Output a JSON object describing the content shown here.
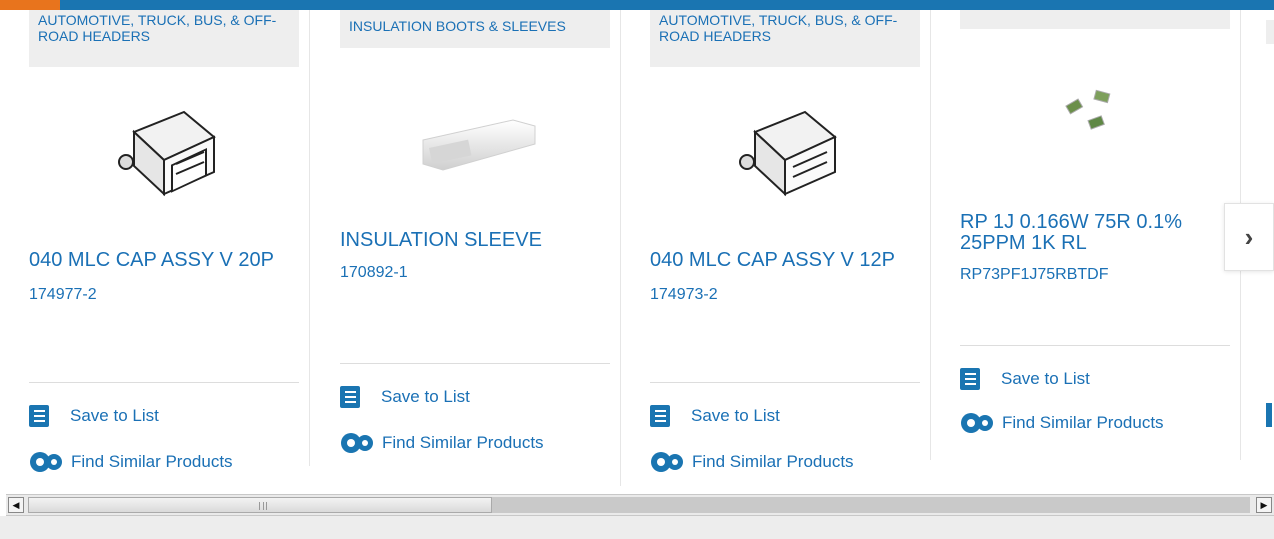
{
  "colors": {
    "accent_blue": "#1a75b1",
    "accent_orange": "#e8741d",
    "link": "#1a70b5"
  },
  "cards": [
    {
      "category": "AUTOMOTIVE, TRUCK, BUS, & OFF-ROAD HEADERS",
      "title": "040 MLC CAP ASSY V 20P",
      "part_number": "174977-2",
      "image": "header-connector-image",
      "save_label": "Save to List",
      "similar_label": "Find Similar Products"
    },
    {
      "category": "INSULATION BOOTS & SLEEVES",
      "title": "INSULATION SLEEVE",
      "part_number": "170892-1",
      "image": "insulation-sleeve-image",
      "save_label": "Save to List",
      "similar_label": "Find Similar Products"
    },
    {
      "category": "AUTOMOTIVE, TRUCK, BUS, & OFF-ROAD HEADERS",
      "title": "040 MLC CAP ASSY V 12P",
      "part_number": "174973-2",
      "image": "header-connector-image",
      "save_label": "Save to List",
      "similar_label": "Find Similar Products"
    },
    {
      "category": "",
      "title": "RP 1J 0.166W 75R 0.1% 25PPM 1K RL",
      "part_number": "RP73PF1J75RBTDF",
      "image": "chip-resistor-image",
      "save_label": "Save to List",
      "similar_label": "Find Similar Products"
    }
  ],
  "carousel": {
    "next_icon": "chevron-right-icon",
    "next_glyph": "›"
  },
  "scrollbar": {
    "left_arrow": "◀",
    "right_arrow": "▶"
  }
}
